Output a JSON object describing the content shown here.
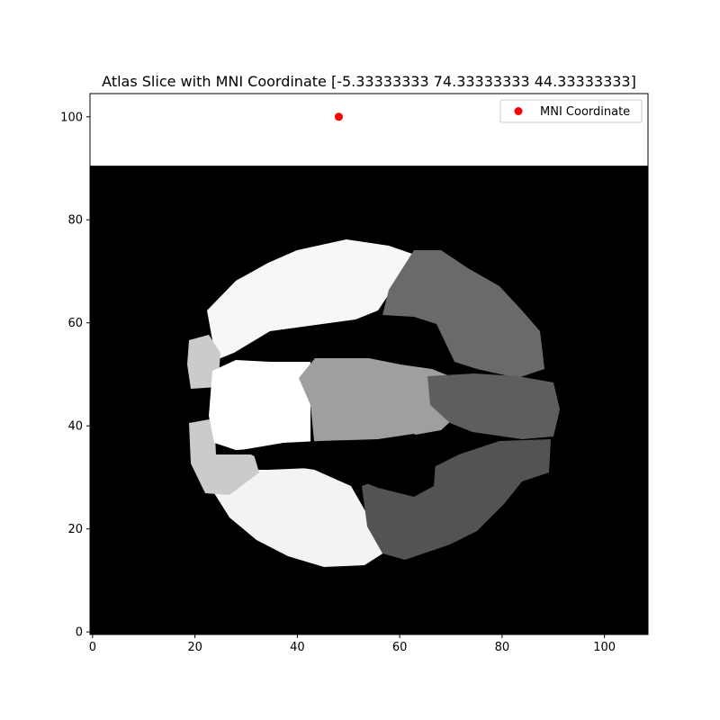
{
  "chart_data": {
    "type": "scatter",
    "title": "Atlas Slice with MNI Coordinate [-5.33333333 74.33333333 44.33333333]",
    "xlabel": "",
    "ylabel": "",
    "xlim": [
      -0.5,
      108.5
    ],
    "ylim": [
      -0.5,
      104.5
    ],
    "xticks": [
      0,
      20,
      40,
      60,
      80,
      100
    ],
    "yticks": [
      0,
      20,
      40,
      60,
      80,
      100
    ],
    "grid": false,
    "legend_position": "upper right",
    "background_image": {
      "kind": "grayscale atlas slice",
      "extent_y_max": 90.5,
      "region_colors": [
        "#000000",
        "#ffffff",
        "#f7f7f7",
        "#f3f3f3",
        "#cbcbcb",
        "#9f9f9f",
        "#6a6a6a",
        "#5e5e5e",
        "#535353"
      ]
    },
    "series": [
      {
        "name": "MNI Coordinate",
        "color": "#ff0000",
        "marker": "circle",
        "points": [
          {
            "x": 48.1,
            "y": 100
          }
        ]
      }
    ]
  }
}
